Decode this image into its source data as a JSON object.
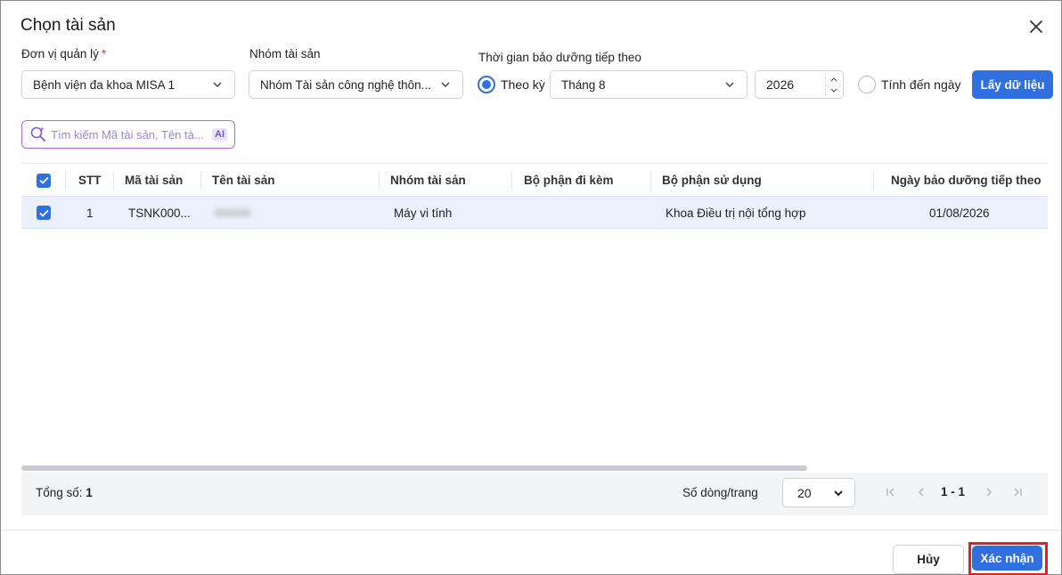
{
  "dialog": {
    "title": "Chọn tài sản"
  },
  "filters": {
    "unit": {
      "label": "Đơn vị quản lý",
      "required_mark": "*",
      "value": "Bệnh viện đa khoa MISA 1"
    },
    "group": {
      "label": "Nhóm tài sản",
      "value": "Nhóm Tài sản công nghệ thôn..."
    },
    "time": {
      "label": "Thời gian bảo dưỡng tiếp theo",
      "by_period_label": "Theo kỳ",
      "period_value": "Tháng 8",
      "year_value": "2026",
      "to_date_label": "Tính đến ngày"
    },
    "fetch_button": "Lấy dữ liệu"
  },
  "search": {
    "placeholder": "Tìm kiếm Mã tài sản, Tên tà...",
    "ai_badge": "AI"
  },
  "table": {
    "columns": [
      "STT",
      "Mã tài sản",
      "Tên tài sản",
      "Nhóm tài sản",
      "Bộ phận đi kèm",
      "Bộ phận sử dụng",
      "Ngày bảo dưỡng tiếp theo"
    ],
    "rows": [
      {
        "stt": "1",
        "code": "TSNK000...",
        "name": "Máy tính",
        "group": "Máy vi tính",
        "attached": "",
        "dept": "Khoa Điều trị nội tổng hợp",
        "next_date": "01/08/2026"
      }
    ]
  },
  "footer": {
    "total_label": "Tổng số:",
    "total_value": "1",
    "rows_per_page_label": "Số dòng/trang",
    "rows_per_page_value": "20",
    "page_info": "1 - 1"
  },
  "actions": {
    "cancel": "Hủy",
    "confirm": "Xác nhận"
  },
  "colors": {
    "primary": "#2f6fe0",
    "highlight_border": "#e31f2a",
    "selected_row": "#eaf1fc"
  }
}
